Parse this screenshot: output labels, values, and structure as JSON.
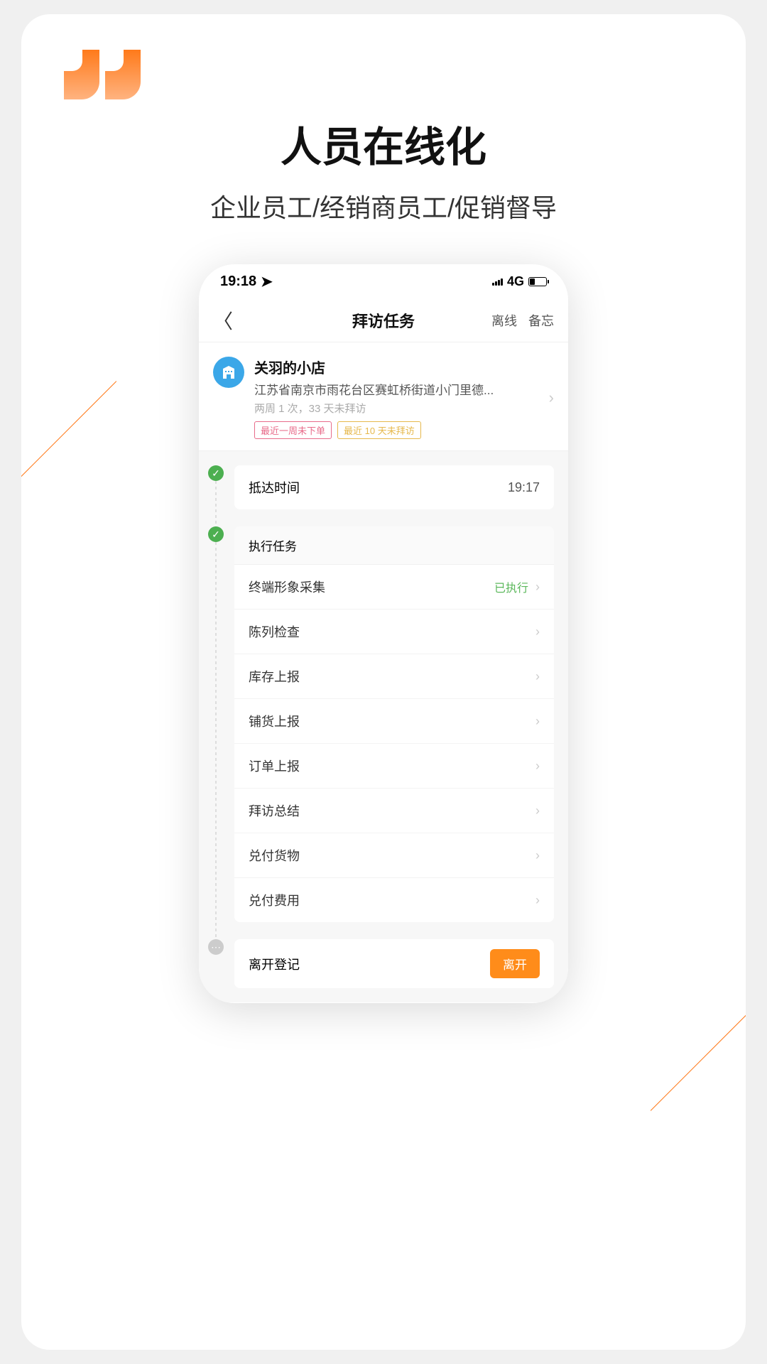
{
  "promo": {
    "headline": "人员在线化",
    "subhead": "企业员工/经销商员工/促销督导"
  },
  "status": {
    "time": "19:18",
    "network": "4G"
  },
  "nav": {
    "title": "拜访任务",
    "action_offline": "离线",
    "action_memo": "备忘"
  },
  "store": {
    "name": "关羽的小店",
    "address": "江苏省南京市雨花台区赛虹桥街道小门里德...",
    "frequency": "两周 1 次，33 天未拜访",
    "tag_no_order": "最近一周未下单",
    "tag_no_visit": "最近 10 天未拜访"
  },
  "arrive": {
    "label": "抵达时间",
    "time": "19:17"
  },
  "tasks": {
    "header": "执行任务",
    "status_done": "已执行",
    "items": [
      {
        "label": "终端形象采集",
        "done": true
      },
      {
        "label": "陈列检查",
        "done": false
      },
      {
        "label": "库存上报",
        "done": false
      },
      {
        "label": "铺货上报",
        "done": false
      },
      {
        "label": "订单上报",
        "done": false
      },
      {
        "label": "拜访总结",
        "done": false
      },
      {
        "label": "兑付货物",
        "done": false
      },
      {
        "label": "兑付费用",
        "done": false
      }
    ]
  },
  "leave": {
    "label": "离开登记",
    "button": "离开"
  }
}
